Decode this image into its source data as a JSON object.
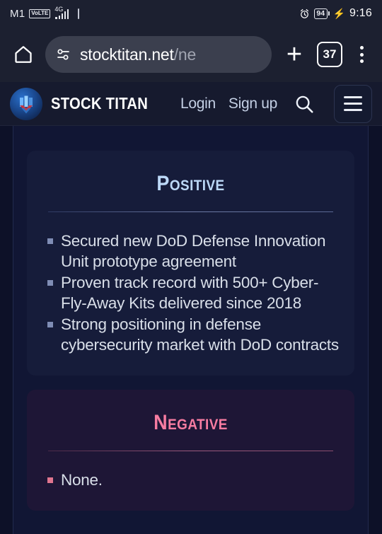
{
  "statusbar": {
    "carrier": "M1",
    "network_badge": "VoLTE",
    "network_type": "4G",
    "network_type_sup": "+",
    "alarm_icon": "alarm-clock-icon",
    "battery_percent": "94",
    "charging_icon": "lightning-bolt-icon",
    "time": "9:16"
  },
  "browser": {
    "home_icon": "home-icon",
    "url_icon": "page-settings-icon",
    "url_visible": "stocktitan.net",
    "url_dim": "/ne",
    "new_tab_label": "+",
    "tab_count": "37",
    "menu_icon": "overflow-menu-icon"
  },
  "site": {
    "logo_icon": "stock-titan-logo-icon",
    "brand": "STOCK TITAN",
    "login_label": "Login",
    "signup_label": "Sign up",
    "search_icon": "search-icon",
    "hamburger_icon": "hamburger-menu-icon"
  },
  "content": {
    "positive": {
      "title": "Positive",
      "bullets": [
        "Secured new DoD Defense Innovation Unit prototype agreement",
        "Proven track record with 500+ Cyber-Fly-Away Kits delivered since 2018",
        "Strong positioning in defense cybersecurity market with DoD contracts"
      ]
    },
    "negative": {
      "title": "Negative",
      "bullets": [
        "None."
      ]
    }
  },
  "colors": {
    "page_bg": "#0d1128",
    "container_bg": "#111634",
    "positive_card_bg": "#161c3a",
    "negative_card_bg": "#1e1636",
    "positive_accent": "#bcd8f7",
    "negative_accent": "#f77ca1",
    "body_text": "#d9dfe9",
    "chrome_bg": "#1c2030"
  }
}
